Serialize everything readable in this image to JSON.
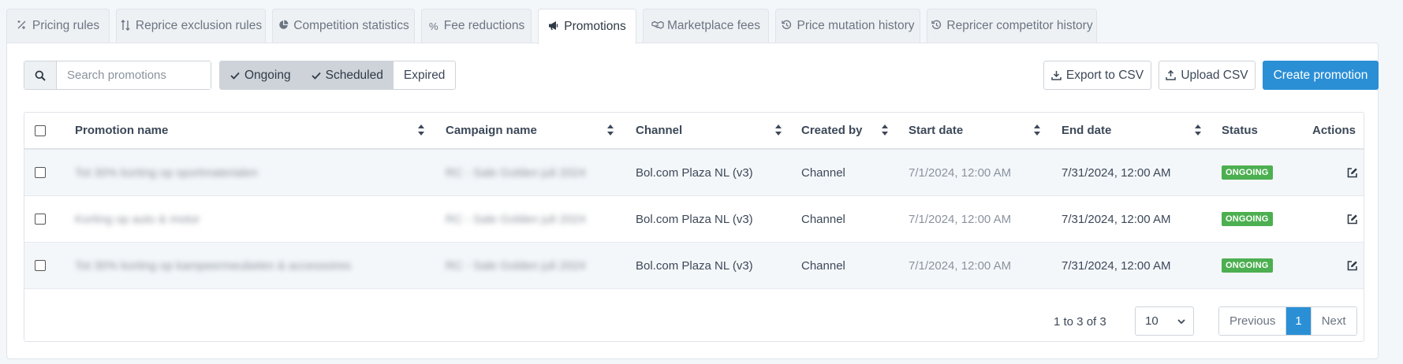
{
  "tabs": [
    {
      "label": "Pricing rules",
      "icon": "rule-icon"
    },
    {
      "label": "Reprice exclusion rules",
      "icon": "sort-arrows-icon"
    },
    {
      "label": "Competition statistics",
      "icon": "pie-chart-icon"
    },
    {
      "label": "Fee reductions",
      "icon": "percent-icon"
    },
    {
      "label": "Promotions",
      "icon": "megaphone-icon",
      "active": true
    },
    {
      "label": "Marketplace fees",
      "icon": "handshake-icon"
    },
    {
      "label": "Price mutation history",
      "icon": "history-icon"
    },
    {
      "label": "Repricer competitor history",
      "icon": "history-icon"
    }
  ],
  "toolbar": {
    "search_placeholder": "Search promotions",
    "filters": [
      {
        "label": "Ongoing",
        "checked": true
      },
      {
        "label": "Scheduled",
        "checked": true
      },
      {
        "label": "Expired",
        "checked": false
      }
    ],
    "export_label": "Export to CSV",
    "upload_label": "Upload CSV",
    "create_label": "Create promotion"
  },
  "table": {
    "columns": [
      "Promotion name",
      "Campaign name",
      "Channel",
      "Created by",
      "Start date",
      "End date",
      "Status",
      "Actions"
    ],
    "rows": [
      {
        "promotion": "Tot 30% korting op sportmaterialen",
        "campaign": "RC - Sale Golden juli 2024",
        "channel": "Bol.com Plaza NL (v3)",
        "created_by": "Channel",
        "start": "7/1/2024, 12:00 AM",
        "end": "7/31/2024, 12:00 AM",
        "status": "ONGOING"
      },
      {
        "promotion": "Korting op auto & motor",
        "campaign": "RC - Sale Golden juli 2024",
        "channel": "Bol.com Plaza NL (v3)",
        "created_by": "Channel",
        "start": "7/1/2024, 12:00 AM",
        "end": "7/31/2024, 12:00 AM",
        "status": "ONGOING"
      },
      {
        "promotion": "Tot 30% korting op kampeermeubelen & accessoires",
        "campaign": "RC - Sale Golden juli 2024",
        "channel": "Bol.com Plaza NL (v3)",
        "created_by": "Channel",
        "start": "7/1/2024, 12:00 AM",
        "end": "7/31/2024, 12:00 AM",
        "status": "ONGOING"
      }
    ]
  },
  "footer": {
    "range_text": "1 to 3 of 3",
    "page_size": "10",
    "previous_label": "Previous",
    "current_page": "1",
    "next_label": "Next"
  },
  "colors": {
    "primary": "#2b8fd6",
    "status_ongoing": "#4caf50"
  }
}
